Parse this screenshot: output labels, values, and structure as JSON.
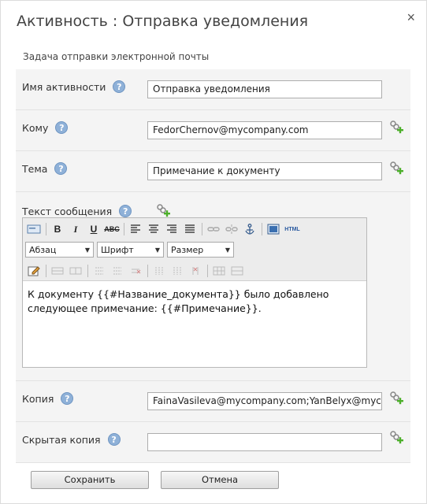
{
  "dialog": {
    "title": "Активность : Отправка уведомления",
    "close_glyph": "×",
    "subtitle": "Задача отправки электронной почты"
  },
  "fields": {
    "name": {
      "label": "Имя активности",
      "value": "Отправка уведомления"
    },
    "to": {
      "label": "Кому",
      "value": "FedorChernov@mycompany.com"
    },
    "subject": {
      "label": "Тема",
      "value": "Примечание к документу"
    },
    "body": {
      "label": "Текст сообщения"
    },
    "cc": {
      "label": "Копия",
      "value": "FainaVasileva@mycompany.com;YanBelyx@mycor"
    },
    "bcc": {
      "label": "Скрытая копия",
      "value": ""
    }
  },
  "help_glyph": "?",
  "editor": {
    "format_select": "Абзац",
    "font_select": "Шрифт",
    "size_select": "Размер",
    "html_label": "HTML",
    "line1": "К документу {{#Название_документа}} было добавлено",
    "line2": "следующее примечание: {{#Примечание}}."
  },
  "buttons": {
    "save": "Сохранить",
    "cancel": "Отмена"
  },
  "colors": {
    "row_bg": "#f4f4f4",
    "help_icon": "#8fb1d8",
    "insert_icon_green": "#4caf2a"
  }
}
